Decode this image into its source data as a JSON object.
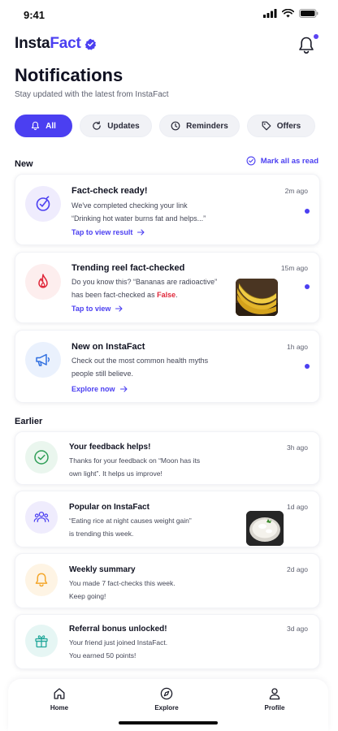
{
  "status_bar": {
    "time": "9:41"
  },
  "header": {
    "brand_part1": "Insta",
    "brand_part2": "Fact"
  },
  "page": {
    "title": "Notifications",
    "subtitle": "Stay updated with the latest from InstaFact"
  },
  "tabs": [
    {
      "label": "All",
      "icon": "bell-icon",
      "active": true
    },
    {
      "label": "Updates",
      "icon": "refresh-icon",
      "active": false
    },
    {
      "label": "Reminders",
      "icon": "clock-icon",
      "active": false
    },
    {
      "label": "Offers",
      "icon": "tag-icon",
      "active": false
    }
  ],
  "sections": {
    "new_label": "New",
    "earlier_label": "Earlier",
    "mark_all_read": "Mark all as read"
  },
  "new_notifications": [
    {
      "title": "Fact-check ready!",
      "time": "2m ago",
      "line1": "We've completed checking your link",
      "line2": "“Drinking hot water burns fat and helps...”",
      "link": "Tap to view result",
      "icon": "check-target-icon",
      "unread": true
    },
    {
      "title": "Trending reel fact-checked",
      "time": "15m ago",
      "line1": "Do you know this? “Bananas are radioactive”",
      "line2_prefix": "has been fact-checked as ",
      "line2_verdict": "False",
      "line2_suffix": ".",
      "link": "Tap to view",
      "icon": "flame-icon",
      "thumbnail": "bananas-image",
      "unread": true
    },
    {
      "title": "New on InstaFact",
      "time": "1h ago",
      "line1": "Check out the most common health myths",
      "line2": "people still believe.",
      "link": "Explore now",
      "icon": "megaphone-icon",
      "unread": true
    }
  ],
  "earlier_notifications": [
    {
      "title": "Your feedback helps!",
      "time": "3h ago",
      "line1": "Thanks for your feedback on “Moon has its",
      "line2": "own light”. It helps us improve!",
      "icon": "check-circle-icon"
    },
    {
      "title": "Popular on InstaFact",
      "time": "1d ago",
      "line1": "“Eating rice at night causes weight gain”",
      "line2": "is trending this week.",
      "icon": "users-icon",
      "thumbnail": "rice-bowl-image"
    },
    {
      "title": "Weekly summary",
      "time": "2d ago",
      "line1": "You made 7 fact-checks this week.",
      "line2": "Keep going!",
      "icon": "bell-icon"
    },
    {
      "title": "Referral bonus unlocked!",
      "time": "3d ago",
      "line1": "Your friend just joined InstaFact.",
      "line2": "You earned 50 points!",
      "icon": "gift-icon"
    }
  ],
  "bottom_nav": [
    {
      "label": "Home",
      "icon": "home-icon"
    },
    {
      "label": "Explore",
      "icon": "compass-icon"
    },
    {
      "label": "Profile",
      "icon": "user-icon"
    }
  ],
  "colors": {
    "accent": "#4b3ff1",
    "danger": "#e0273a",
    "success": "#2f9e57",
    "warning": "#f4a62a",
    "teal": "#21a79a"
  }
}
